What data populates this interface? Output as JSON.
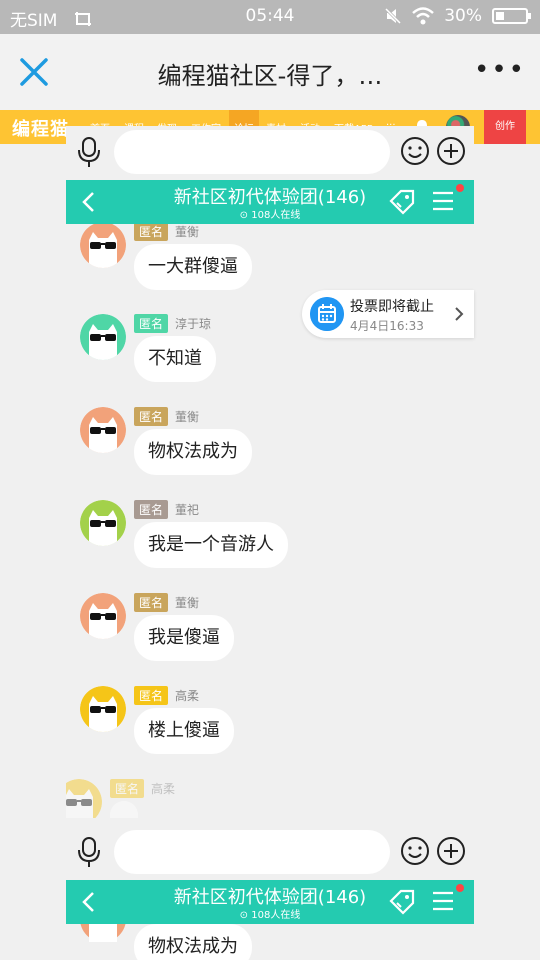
{
  "status_bar": {
    "carrier": "无SIM",
    "time": "05:44",
    "battery": "30%"
  },
  "browser": {
    "title": "编程猫社区-得了，…",
    "more": "•••"
  },
  "site_nav": {
    "logo": "编程猫",
    "items": [
      "首页",
      "课程",
      "发现",
      "工作室",
      "论坛",
      "素材",
      "活动",
      "下载APP",
      "···"
    ],
    "active_item": "论坛",
    "create": "创作"
  },
  "chat": {
    "group_title": "新社区初代体验团(146)",
    "online": "108人在线",
    "anon_badge": "匿名"
  },
  "vote": {
    "title": "投票即将截止",
    "time": "4月4日16:33"
  },
  "messages": [
    {
      "sender": "董衡",
      "text": "一大群傻逼"
    },
    {
      "sender": "淳于琼",
      "text": "不知道"
    },
    {
      "sender": "董衡",
      "text": "物权法成为"
    },
    {
      "sender": "董祀",
      "text": "我是一个音游人"
    },
    {
      "sender": "董衡",
      "text": "我是傻逼"
    },
    {
      "sender": "高柔",
      "text": "楼上傻逼"
    },
    {
      "sender": "高柔",
      "text": ""
    }
  ],
  "bottom_preview": {
    "text": "物权法成为"
  },
  "colors": {
    "accent_teal": "#24cbb0",
    "site_yellow": "#fec433",
    "create_red": "#ee4444"
  },
  "icons": [
    "close-icon",
    "more-icon",
    "bell-icon",
    "mic-icon",
    "emoji-icon",
    "plus-icon",
    "back-icon",
    "tag-icon",
    "menu-icon",
    "calendar-icon",
    "chevron-right-icon"
  ]
}
